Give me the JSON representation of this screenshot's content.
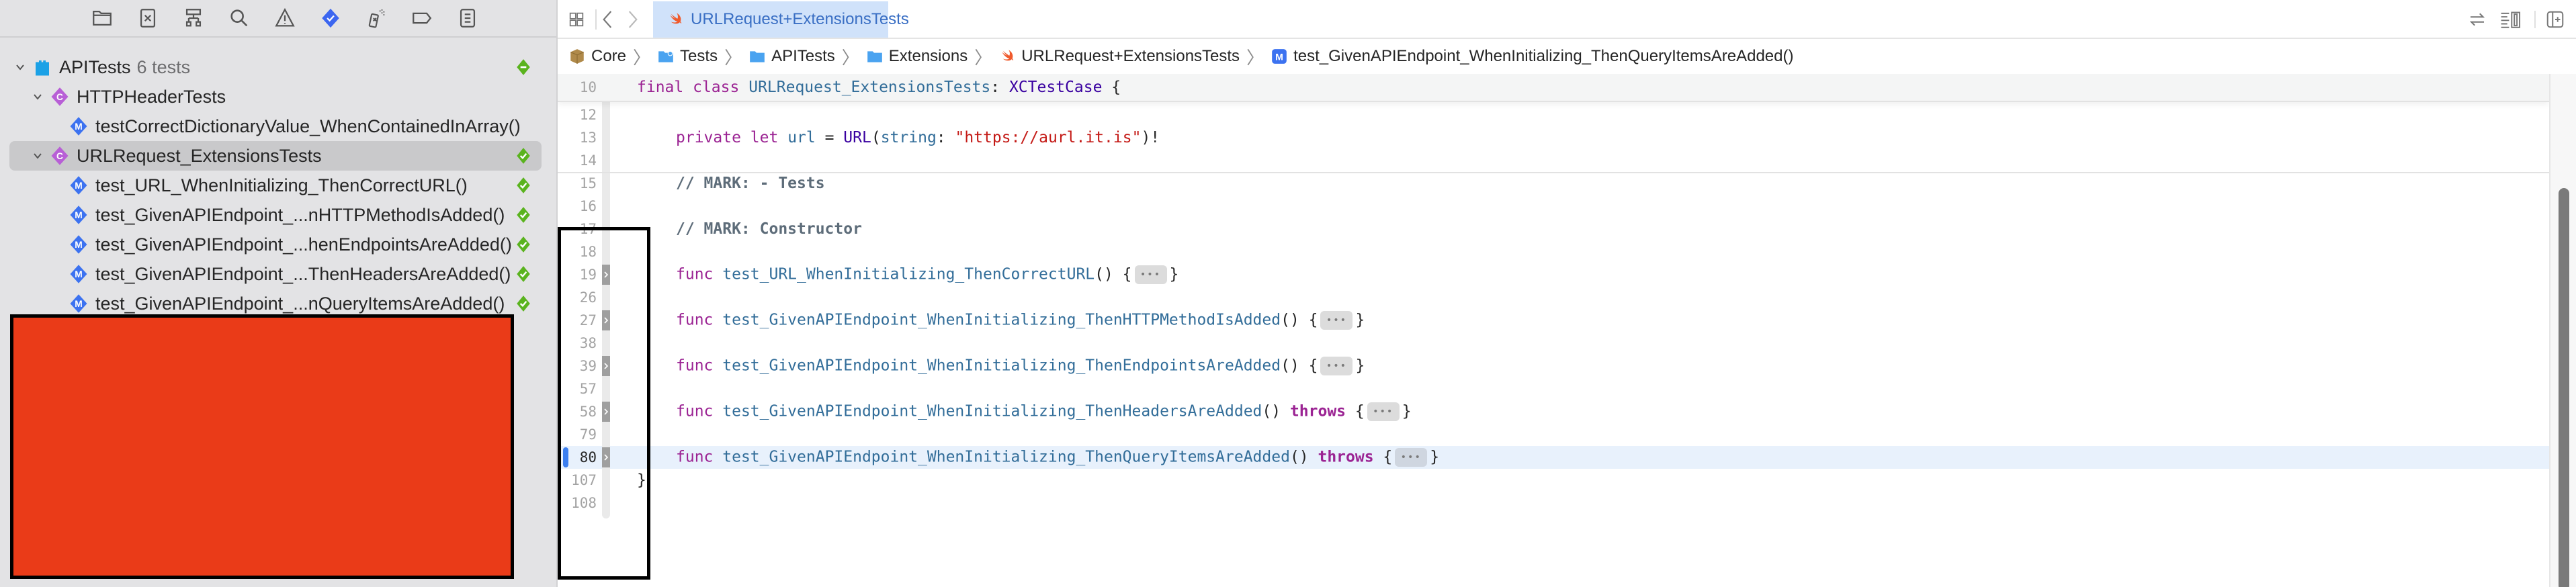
{
  "navigator": {
    "toolbar": [
      {
        "name": "project-navigator",
        "icon": "folder-icon"
      },
      {
        "name": "source-control-navigator",
        "icon": "source-control-icon"
      },
      {
        "name": "symbol-navigator",
        "icon": "hierarchy-icon"
      },
      {
        "name": "find-navigator",
        "icon": "search-icon"
      },
      {
        "name": "issue-navigator",
        "icon": "warning-icon"
      },
      {
        "name": "test-navigator",
        "icon": "test-diamond-icon",
        "active": true
      },
      {
        "name": "debug-navigator",
        "icon": "spray-icon"
      },
      {
        "name": "breakpoint-navigator",
        "icon": "breakpoint-tag-icon"
      },
      {
        "name": "report-navigator",
        "icon": "report-list-icon"
      }
    ],
    "tree": [
      {
        "label": "APITests",
        "sub": "6 tests",
        "kind": "test-bundle",
        "level": 0,
        "expanded": true,
        "status": "mixed"
      },
      {
        "label": "HTTPHeaderTests",
        "kind": "class",
        "level": 1,
        "expanded": true,
        "status": ""
      },
      {
        "label": "testCorrectDictionaryValue_WhenContainedInArray()",
        "kind": "method",
        "level": 2,
        "status": ""
      },
      {
        "label": "URLRequest_ExtensionsTests",
        "kind": "class",
        "level": 1,
        "expanded": true,
        "selected": true,
        "status": "passed"
      },
      {
        "label": "test_URL_WhenInitializing_ThenCorrectURL()",
        "kind": "method",
        "level": 2,
        "status": "passed"
      },
      {
        "label": "test_GivenAPIEndpoint_...nHTTPMethodIsAdded()",
        "kind": "method",
        "level": 2,
        "status": "passed"
      },
      {
        "label": "test_GivenAPIEndpoint_...henEndpointsAreAdded()",
        "kind": "method",
        "level": 2,
        "status": "passed"
      },
      {
        "label": "test_GivenAPIEndpoint_...ThenHeadersAreAdded()",
        "kind": "method",
        "level": 2,
        "status": "passed"
      },
      {
        "label": "test_GivenAPIEndpoint_...nQueryItemsAreAdded()",
        "kind": "method",
        "level": 2,
        "status": "passed"
      }
    ],
    "class_badge": "C",
    "method_badge": "M"
  },
  "editor": {
    "tab": {
      "label": "URLRequest+ExtensionsTests",
      "icon": "swift-icon"
    },
    "breadcrumb": [
      {
        "label": "Core",
        "icon": "package-icon"
      },
      {
        "label": "Tests",
        "icon": "folder-gear-icon"
      },
      {
        "label": "APITests",
        "icon": "folder-icon"
      },
      {
        "label": "Extensions",
        "icon": "folder-icon"
      },
      {
        "label": "URLRequest+ExtensionsTests",
        "icon": "swift-icon"
      },
      {
        "label": "test_GivenAPIEndpoint_WhenInitializing_ThenQueryItemsAreAdded()",
        "icon": "method-icon"
      }
    ],
    "sticky_line": {
      "no": "10",
      "tokens": [
        [
          "kw",
          "final"
        ],
        [
          "plain",
          " "
        ],
        [
          "kw",
          "class"
        ],
        [
          "plain",
          " "
        ],
        [
          "ident",
          "URLRequest_ExtensionsTests"
        ],
        [
          "plain",
          ": "
        ],
        [
          "type",
          "XCTestCase"
        ],
        [
          "plain",
          " {"
        ]
      ]
    },
    "lines": [
      {
        "no": "12",
        "tokens": []
      },
      {
        "no": "13",
        "indent": true,
        "tokens": [
          [
            "kw",
            "private"
          ],
          [
            "plain",
            " "
          ],
          [
            "kw",
            "let"
          ],
          [
            "plain",
            " "
          ],
          [
            "ident",
            "url"
          ],
          [
            "plain",
            " = "
          ],
          [
            "type",
            "URL"
          ],
          [
            "plain",
            "("
          ],
          [
            "ident",
            "string"
          ],
          [
            "plain",
            ": "
          ],
          [
            "str",
            "\"https://aurl.it.is\""
          ],
          [
            "plain",
            ")!"
          ]
        ]
      },
      {
        "no": "14",
        "tokens": []
      },
      {
        "no": "15",
        "indent": true,
        "tokens": [
          [
            "cmt",
            "// MARK: - Tests"
          ]
        ]
      },
      {
        "no": "16",
        "tokens": []
      },
      {
        "no": "17",
        "indent": true,
        "tokens": [
          [
            "cmt",
            "// MARK: Constructor"
          ]
        ]
      },
      {
        "no": "18",
        "tokens": []
      },
      {
        "no": "19",
        "indent": true,
        "folded": true,
        "tokens": [
          [
            "kw",
            "func"
          ],
          [
            "plain",
            " "
          ],
          [
            "fn",
            "test_URL_WhenInitializing_ThenCorrectURL"
          ],
          [
            "plain",
            "() {"
          ],
          [
            "ellipsis",
            "•••"
          ],
          [
            "plain",
            "}"
          ]
        ]
      },
      {
        "no": "26",
        "tokens": []
      },
      {
        "no": "27",
        "indent": true,
        "folded": true,
        "tokens": [
          [
            "kw",
            "func"
          ],
          [
            "plain",
            " "
          ],
          [
            "fn",
            "test_GivenAPIEndpoint_WhenInitializing_ThenHTTPMethodIsAdded"
          ],
          [
            "plain",
            "() {"
          ],
          [
            "ellipsis",
            "•••"
          ],
          [
            "plain",
            "}"
          ]
        ]
      },
      {
        "no": "38",
        "tokens": []
      },
      {
        "no": "39",
        "indent": true,
        "folded": true,
        "tokens": [
          [
            "kw",
            "func"
          ],
          [
            "plain",
            " "
          ],
          [
            "fn",
            "test_GivenAPIEndpoint_WhenInitializing_ThenEndpointsAreAdded"
          ],
          [
            "plain",
            "() {"
          ],
          [
            "ellipsis",
            "•••"
          ],
          [
            "plain",
            "}"
          ]
        ]
      },
      {
        "no": "57",
        "tokens": []
      },
      {
        "no": "58",
        "indent": true,
        "folded": true,
        "tokens": [
          [
            "kw",
            "func"
          ],
          [
            "plain",
            " "
          ],
          [
            "fn",
            "test_GivenAPIEndpoint_WhenInitializing_ThenHeadersAreAdded"
          ],
          [
            "plain",
            "() "
          ],
          [
            "kw-b",
            "throws"
          ],
          [
            "plain",
            " {"
          ],
          [
            "ellipsis",
            "•••"
          ],
          [
            "plain",
            "}"
          ]
        ]
      },
      {
        "no": "79",
        "tokens": []
      },
      {
        "no": "80",
        "indent": true,
        "folded": true,
        "current": true,
        "tokens": [
          [
            "kw",
            "func"
          ],
          [
            "plain",
            " "
          ],
          [
            "fn",
            "test_GivenAPIEndpoint_WhenInitializing_ThenQueryItemsAreAdded"
          ],
          [
            "plain",
            "() "
          ],
          [
            "kw-b",
            "throws"
          ],
          [
            "plain",
            " {"
          ],
          [
            "ellipsis",
            "•••"
          ],
          [
            "plain",
            "}"
          ]
        ]
      },
      {
        "no": "107",
        "tokens": [
          [
            "plain",
            "}"
          ]
        ]
      },
      {
        "no": "108",
        "tokens": []
      }
    ]
  },
  "colors": {
    "accent": "#3c7ff0",
    "passed": "#5ab31e",
    "class_badge": "#b85fd6",
    "redaction": "#ea3b18"
  }
}
